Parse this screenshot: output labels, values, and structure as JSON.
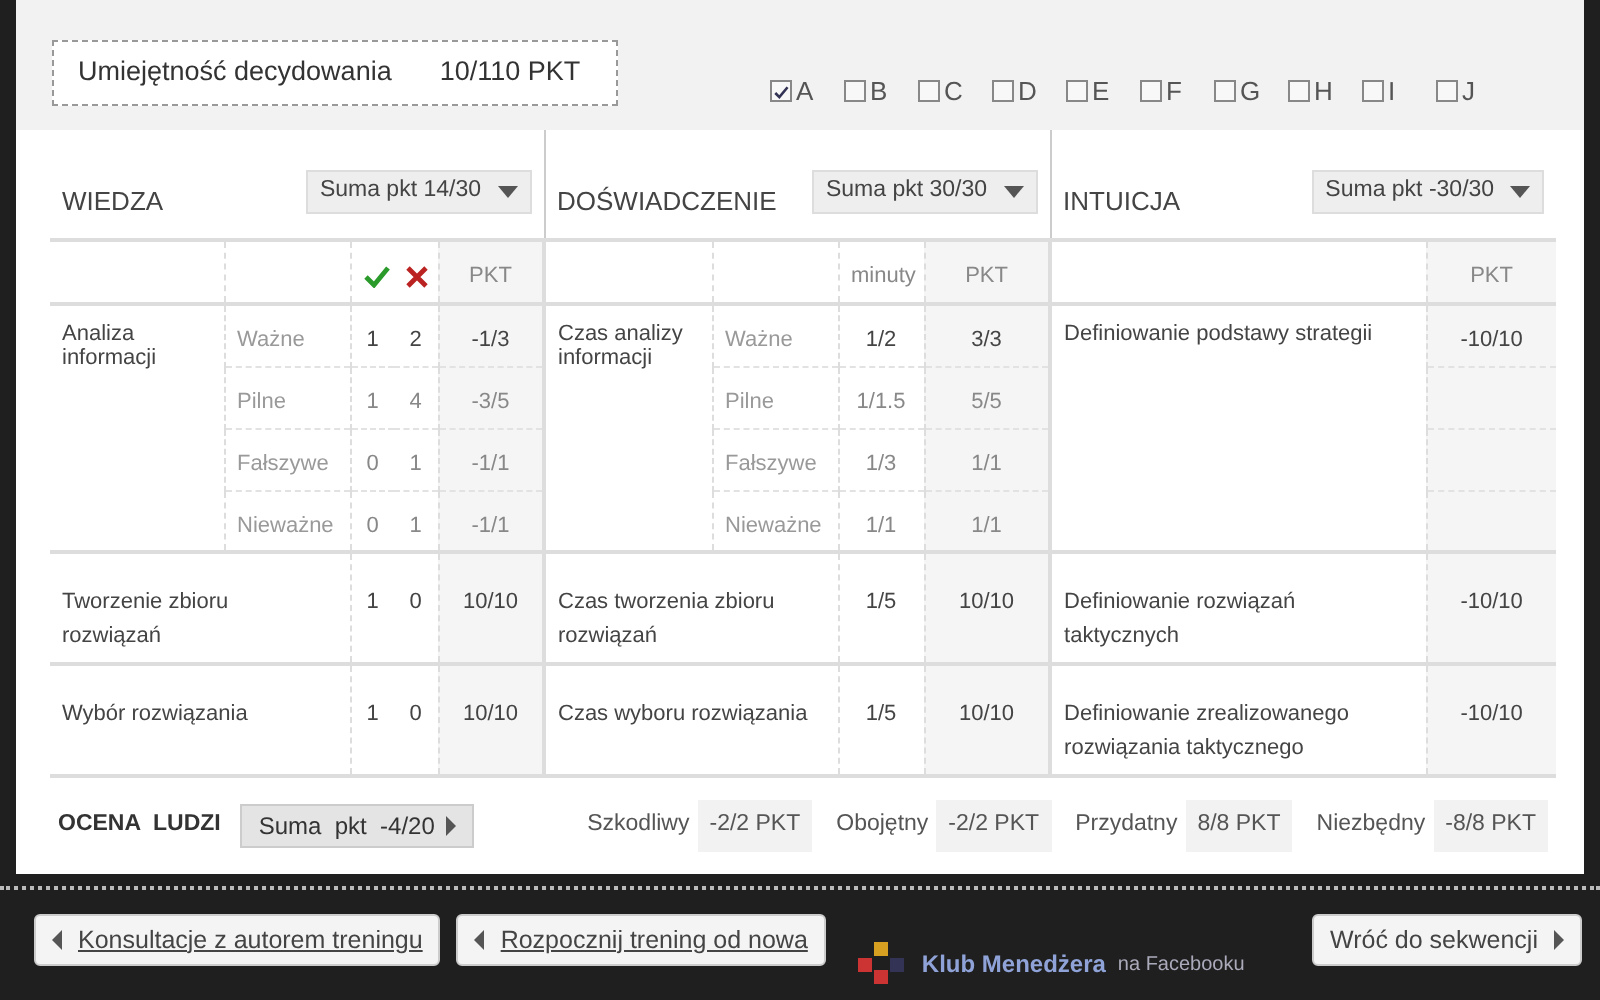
{
  "header": {
    "skill_label": "Umiejętność decydowania",
    "skill_score": "10/110 PKT",
    "filters": [
      {
        "label": "A",
        "checked": true
      },
      {
        "label": "B",
        "checked": false
      },
      {
        "label": "C",
        "checked": false
      },
      {
        "label": "D",
        "checked": false
      },
      {
        "label": "E",
        "checked": false
      },
      {
        "label": "F",
        "checked": false
      },
      {
        "label": "G",
        "checked": false
      },
      {
        "label": "H",
        "checked": false
      },
      {
        "label": "I",
        "checked": false
      },
      {
        "label": "J",
        "checked": false
      }
    ]
  },
  "wiedza": {
    "title": "WIEDZA",
    "sum": "Suma pkt 14/30",
    "pkt_header": "PKT",
    "groups": [
      {
        "label": "Analiza informacji",
        "subrows": [
          {
            "label": "Ważne",
            "correct": "1",
            "wrong": "2",
            "pkt": "-1/3"
          },
          {
            "label": "Pilne",
            "correct": "1",
            "wrong": "4",
            "pkt": "-3/5"
          },
          {
            "label": "Fałszywe",
            "correct": "0",
            "wrong": "1",
            "pkt": "-1/1"
          },
          {
            "label": "Nieważne",
            "correct": "0",
            "wrong": "1",
            "pkt": "-1/1"
          }
        ]
      },
      {
        "label": "Tworzenie zbioru rozwiązań",
        "correct": "1",
        "wrong": "0",
        "pkt": "10/10"
      },
      {
        "label": "Wybór rozwiązania",
        "correct": "1",
        "wrong": "0",
        "pkt": "10/10"
      }
    ]
  },
  "doswiadczenie": {
    "title": "DOŚWIADCZENIE",
    "sum": "Suma pkt 30/30",
    "minutes_header": "minuty",
    "pkt_header": "PKT",
    "groups": [
      {
        "label": "Czas analizy informacji",
        "subrows": [
          {
            "label": "Ważne",
            "minutes": "1/2",
            "pkt": "3/3"
          },
          {
            "label": "Pilne",
            "minutes": "1/1.5",
            "pkt": "5/5"
          },
          {
            "label": "Fałszywe",
            "minutes": "1/3",
            "pkt": "1/1"
          },
          {
            "label": "Nieważne",
            "minutes": "1/1",
            "pkt": "1/1"
          }
        ]
      },
      {
        "label": "Czas tworzenia zbioru rozwiązań",
        "minutes": "1/5",
        "pkt": "10/10"
      },
      {
        "label": "Czas wyboru rozwiązania",
        "minutes": "1/5",
        "pkt": "10/10"
      }
    ]
  },
  "intuicja": {
    "title": "INTUICJA",
    "sum": "Suma pkt -30/30",
    "pkt_header": "PKT",
    "groups": [
      {
        "label": "Definiowanie podstawy strategii",
        "pkt": "-10/10"
      },
      {
        "label": "Definiowanie rozwiązań taktycznych",
        "pkt": "-10/10"
      },
      {
        "label": "Definiowanie zrealizowanego rozwiązania taktycznego",
        "pkt": "-10/10"
      }
    ]
  },
  "ocena_ludzi": {
    "title": "OCENA  LUDZI",
    "sum": "Suma  pkt  -4/20",
    "categories": [
      {
        "label": "Szkodliwy",
        "value": "-2/2 PKT"
      },
      {
        "label": "Obojętny",
        "value": "-2/2 PKT"
      },
      {
        "label": "Przydatny",
        "value": "8/8 PKT"
      },
      {
        "label": "Niezbędny",
        "value": "-8/8 PKT"
      }
    ]
  },
  "buttons": [
    {
      "label": "Konsultacje z autorem treningu",
      "kind": "back"
    },
    {
      "label": "Rozpocznij trening od nowa",
      "kind": "back"
    },
    {
      "label": "Wróć do sekwencji",
      "kind": "forward"
    }
  ],
  "background": {
    "club_name": "Klub Menedżera",
    "club_suffix": "na Facebooku"
  }
}
